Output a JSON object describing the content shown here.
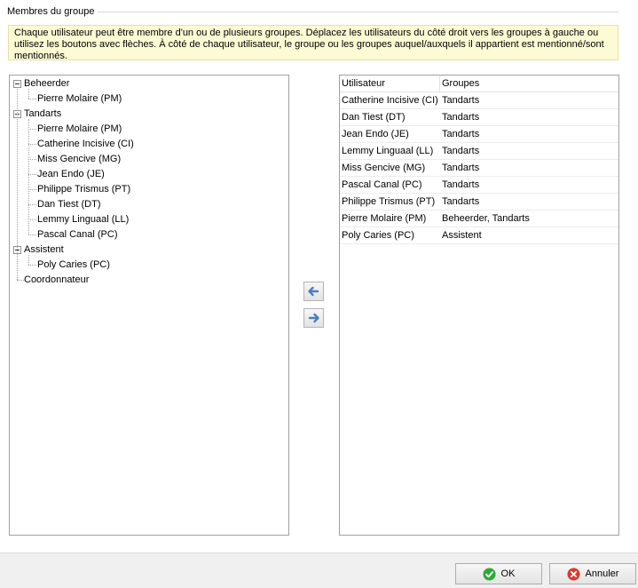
{
  "group": {
    "title": "Membres du groupe",
    "info": "Chaque utilisateur peut être membre d'un ou de plusieurs groupes. Déplacez les utilisateurs du côté droit vers les groupes à gauche ou utilisez les boutons avec flèches. À côté de chaque utilisateur, le groupe ou les groupes auquel/auxquels il appartient est mentionné/sont mentionnés."
  },
  "tree": {
    "groups": [
      {
        "label": "Beheerder",
        "members": [
          "Pierre Molaire (PM)"
        ]
      },
      {
        "label": "Tandarts",
        "members": [
          "Pierre Molaire (PM)",
          "Catherine Incisive (CI)",
          "Miss Gencive (MG)",
          "Jean Endo (JE)",
          "Philippe Trismus (PT)",
          "Dan Tiest (DT)",
          "Lemmy Linguaal (LL)",
          "Pascal Canal (PC)"
        ]
      },
      {
        "label": "Assistent",
        "members": [
          "Poly Caries (PC)"
        ]
      },
      {
        "label": "Coordonnateur",
        "members": []
      }
    ]
  },
  "table": {
    "headers": [
      "Utilisateur",
      "Groupes"
    ],
    "rows": [
      [
        "Catherine Incisive (CI)",
        "Tandarts"
      ],
      [
        "Dan Tiest (DT)",
        "Tandarts"
      ],
      [
        "Jean Endo (JE)",
        "Tandarts"
      ],
      [
        "Lemmy Linguaal (LL)",
        "Tandarts"
      ],
      [
        "Miss Gencive (MG)",
        "Tandarts"
      ],
      [
        "Pascal Canal (PC)",
        "Tandarts"
      ],
      [
        "Philippe Trismus (PT)",
        "Tandarts"
      ],
      [
        "Pierre Molaire (PM)",
        "Beheerder, Tandarts"
      ],
      [
        "Poly Caries (PC)",
        "Assistent"
      ]
    ]
  },
  "buttons": {
    "move_left_icon": "arrow-left-icon",
    "move_right_icon": "arrow-right-icon",
    "ok_label": "OK",
    "cancel_label": "Annuler"
  },
  "colors": {
    "info_bg": "#fdfbd3",
    "arrow_blue": "#4a7fc0",
    "ok_green": "#2fa836",
    "cancel_red": "#d93a2b"
  }
}
